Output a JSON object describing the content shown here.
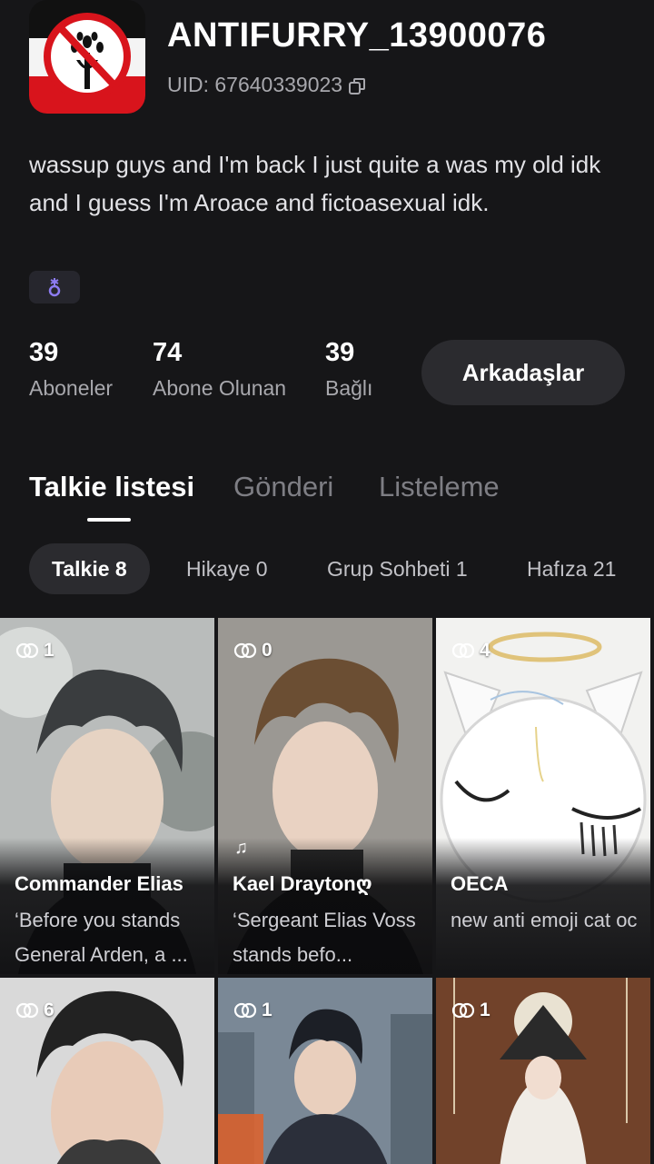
{
  "profile": {
    "username": "ANTIFURRY_13900076",
    "uid_label": "UID: 67640339023",
    "bio": "wassup guys and I'm back I just quite a was my old idk and I guess I'm Aroace and fictoasexual idk."
  },
  "stats": [
    {
      "value": "39",
      "label": "Aboneler"
    },
    {
      "value": "74",
      "label": "Abone Olunan"
    },
    {
      "value": "39",
      "label": "Bağlı"
    }
  ],
  "friends_button": "Arkadaşlar",
  "tabs": [
    "Talkie listesi",
    "Gönderi",
    "Listeleme"
  ],
  "chips": [
    "Talkie 8",
    "Hikaye 0",
    "Grup Sohbeti 1",
    "Hafıza 21"
  ],
  "cards": [
    {
      "count": "1",
      "name": "Commander Elias",
      "desc": "‘Before you stands General Arden, a ..."
    },
    {
      "count": "0",
      "name": "Kael Draytonღ",
      "desc": "‘Sergeant Elias Voss stands befo..."
    },
    {
      "count": "4",
      "name": "OECA",
      "desc": "new anti emoji cat oc"
    },
    {
      "count": "6"
    },
    {
      "count": "1"
    },
    {
      "count": "1"
    }
  ],
  "colors": {
    "background": "#161618",
    "button_bg": "#2b2b2f",
    "muted_text": "#a8a8ad",
    "badge_icon": "#8d7cf2"
  },
  "icons": [
    "copy-icon",
    "link-icon",
    "music-note-icon",
    "gender-badge-icon"
  ]
}
